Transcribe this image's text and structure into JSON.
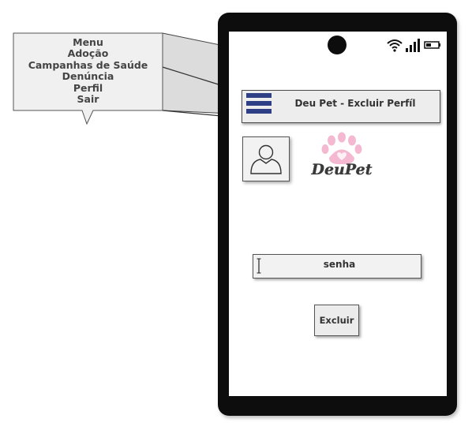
{
  "callout": {
    "title": "Menu",
    "items": [
      {
        "label": "Adoção"
      },
      {
        "label": "Campanhas de Saúde"
      },
      {
        "label": "Denúncia"
      },
      {
        "label": "Perfil"
      },
      {
        "label": "Sair"
      }
    ]
  },
  "header": {
    "title": "Deu Pet - Excluir Perfíl"
  },
  "logo": {
    "text": "DeuPet"
  },
  "password": {
    "placeholder": "senha"
  },
  "delete_button": {
    "label": "Excluir"
  },
  "colors": {
    "menu_icon": "#2f3f86",
    "paw": "#f4b8d0",
    "phone": "#0d0d0d"
  }
}
